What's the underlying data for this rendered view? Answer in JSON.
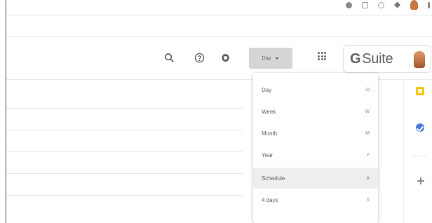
{
  "view_select": {
    "label": "Day"
  },
  "menu": {
    "items": [
      {
        "label": "Day",
        "shortcut": "D"
      },
      {
        "label": "Week",
        "shortcut": "W"
      },
      {
        "label": "Month",
        "shortcut": "M"
      },
      {
        "label": "Year",
        "shortcut": "Y"
      },
      {
        "label": "Schedule",
        "shortcut": "A",
        "highlighted": true
      },
      {
        "label": "4 days",
        "shortcut": "X"
      }
    ]
  },
  "brand": {
    "g": "G",
    "suite": "Suite"
  },
  "icons": {
    "search": "search-icon",
    "help": "help-icon",
    "settings": "settings-icon",
    "apps": "apps-grid-icon",
    "keep": "keep-icon",
    "tasks": "tasks-icon",
    "add": "add-icon"
  },
  "colors": {
    "accent_yellow": "#f6c619",
    "accent_blue": "#4b7bd8",
    "view_button_bg": "#d5d5d5",
    "menu_highlight": "#eeeeee"
  }
}
